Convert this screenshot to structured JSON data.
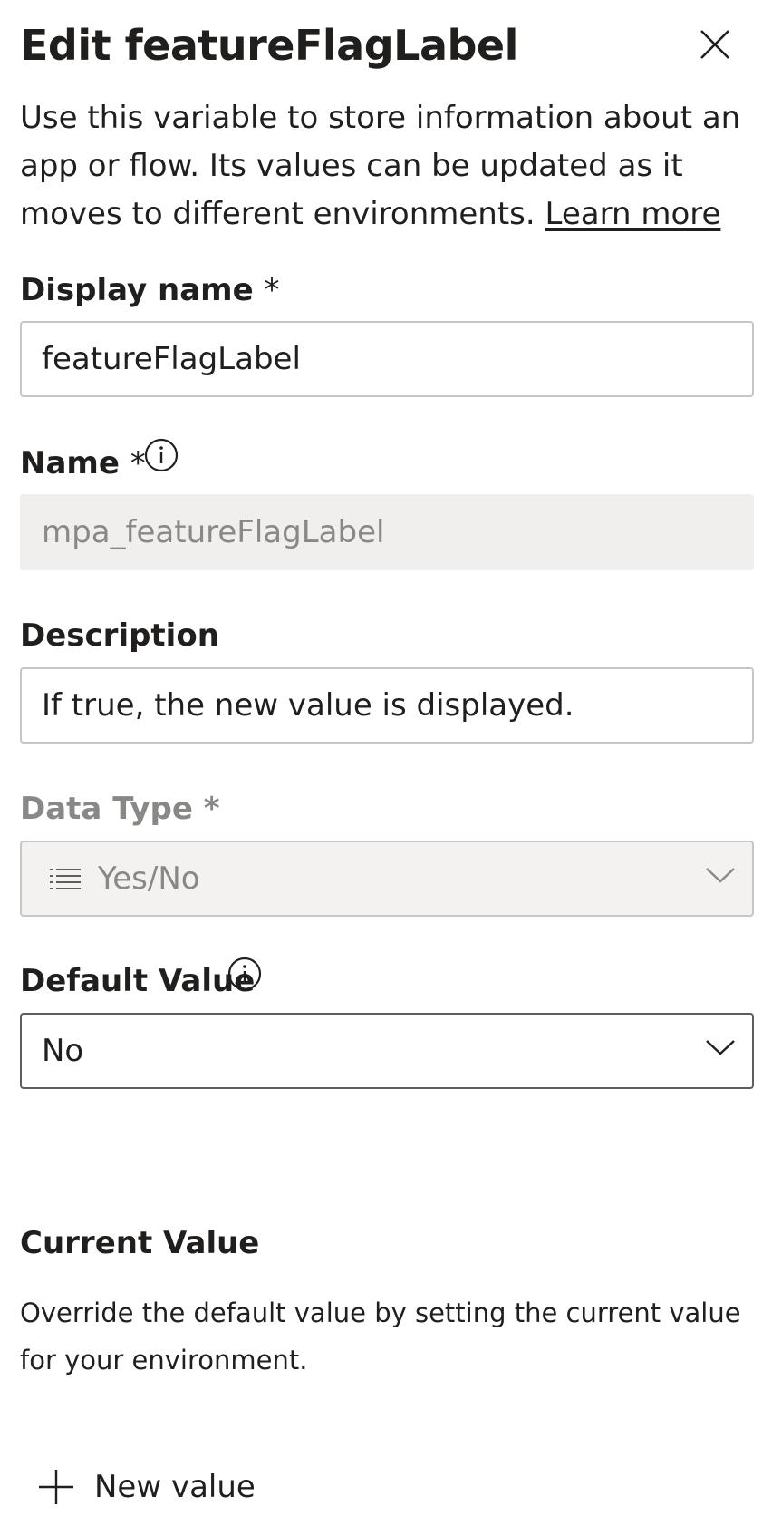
{
  "header": {
    "title": "Edit featureFlagLabel",
    "close_icon": "close-icon"
  },
  "intro": {
    "text": "Use this variable to store information about an app or flow. Its values can be updated as it moves to different environments. ",
    "link": "Learn more"
  },
  "display_name": {
    "label": "Display name",
    "required": "*",
    "value": "featureFlagLabel"
  },
  "name": {
    "label": "Name",
    "required": "*",
    "value": "mpa_featureFlagLabel"
  },
  "description": {
    "label": "Description",
    "value": "If true, the new value is displayed."
  },
  "data_type": {
    "label": "Data Type",
    "required": "*",
    "value": "Yes/No",
    "icon": "list-icon"
  },
  "default_value": {
    "label": "Default Value",
    "value": "No"
  },
  "current_value": {
    "title": "Current Value",
    "description": "Override the default value by setting the current value for your environment."
  },
  "actions": {
    "new_value": "New value"
  },
  "colors": {
    "text": "#201f1e",
    "disabled_text": "#8a8886",
    "readonly_bg": "#f0efee",
    "border": "#c8c6c4"
  }
}
